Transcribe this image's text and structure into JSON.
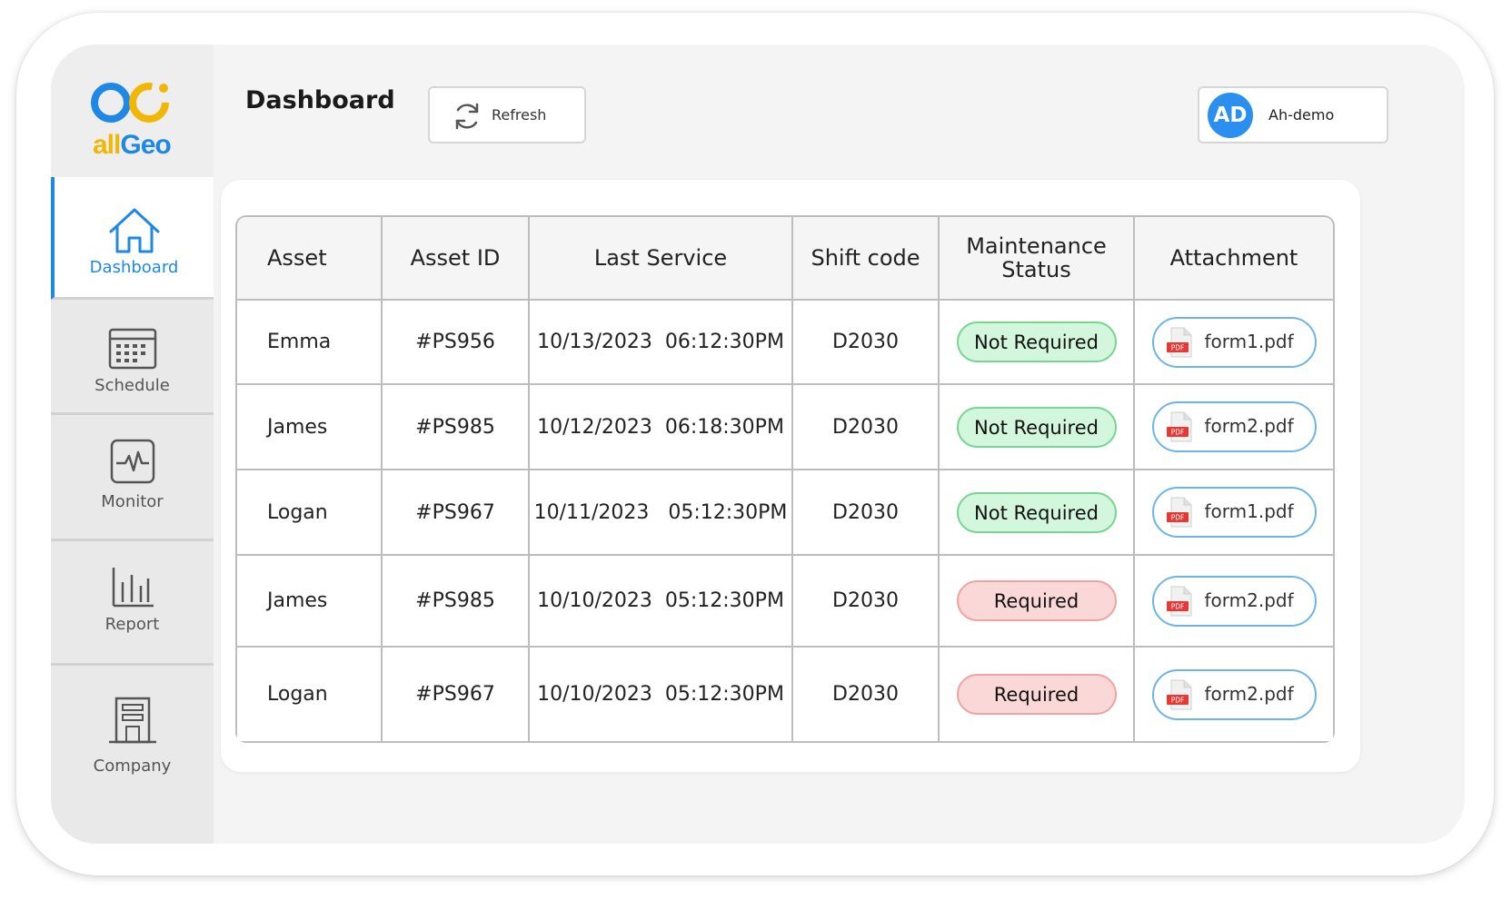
{
  "brand": {
    "logo_text_part1": "all",
    "logo_text_part2": "Geo"
  },
  "sidebar": {
    "items": [
      {
        "label": "Dashboard",
        "icon": "home-icon",
        "active": true
      },
      {
        "label": "Schedule",
        "icon": "calendar-icon",
        "active": false
      },
      {
        "label": "Monitor",
        "icon": "pulse-monitor-icon",
        "active": false
      },
      {
        "label": "Report",
        "icon": "bar-chart-icon",
        "active": false
      },
      {
        "label": "Company",
        "icon": "building-icon",
        "active": false
      }
    ]
  },
  "header": {
    "title": "Dashboard",
    "refresh_label": "Refresh",
    "user": {
      "initials": "AD",
      "name": "Ah-demo"
    }
  },
  "table": {
    "columns": [
      "Asset",
      "Asset ID",
      "Last Service",
      "Shift code",
      "Maintenance Status",
      "Attachment"
    ],
    "rows": [
      {
        "asset": "Emma",
        "asset_id": "#PS956",
        "last_service": "10/13/2023  06:12:30PM",
        "shift_code": "D2030",
        "status": "Not Required",
        "attachment": "form1.pdf"
      },
      {
        "asset": "James",
        "asset_id": "#PS985",
        "last_service": "10/12/2023  06:18:30PM",
        "shift_code": "D2030",
        "status": "Not Required",
        "attachment": "form2.pdf"
      },
      {
        "asset": "Logan",
        "asset_id": "#PS967",
        "last_service": "10/11/2023   05:12:30PM",
        "shift_code": "D2030",
        "status": "Not Required",
        "attachment": "form1.pdf"
      },
      {
        "asset": "James",
        "asset_id": "#PS985",
        "last_service": "10/10/2023  05:12:30PM",
        "shift_code": "D2030",
        "status": "Required",
        "attachment": "form2.pdf"
      },
      {
        "asset": "Logan",
        "asset_id": "#PS967",
        "last_service": "10/10/2023  05:12:30PM",
        "shift_code": "D2030",
        "status": "Required",
        "attachment": "form2.pdf"
      }
    ],
    "pdf_badge": "PDF"
  },
  "colors": {
    "accent": "#1e88e5",
    "logo_yellow": "#f2b705",
    "status_ok_bg": "#d3f7dc",
    "status_required_bg": "#fbd8d8",
    "avatar": "#2b8ff0",
    "pdf_red": "#e53935"
  }
}
